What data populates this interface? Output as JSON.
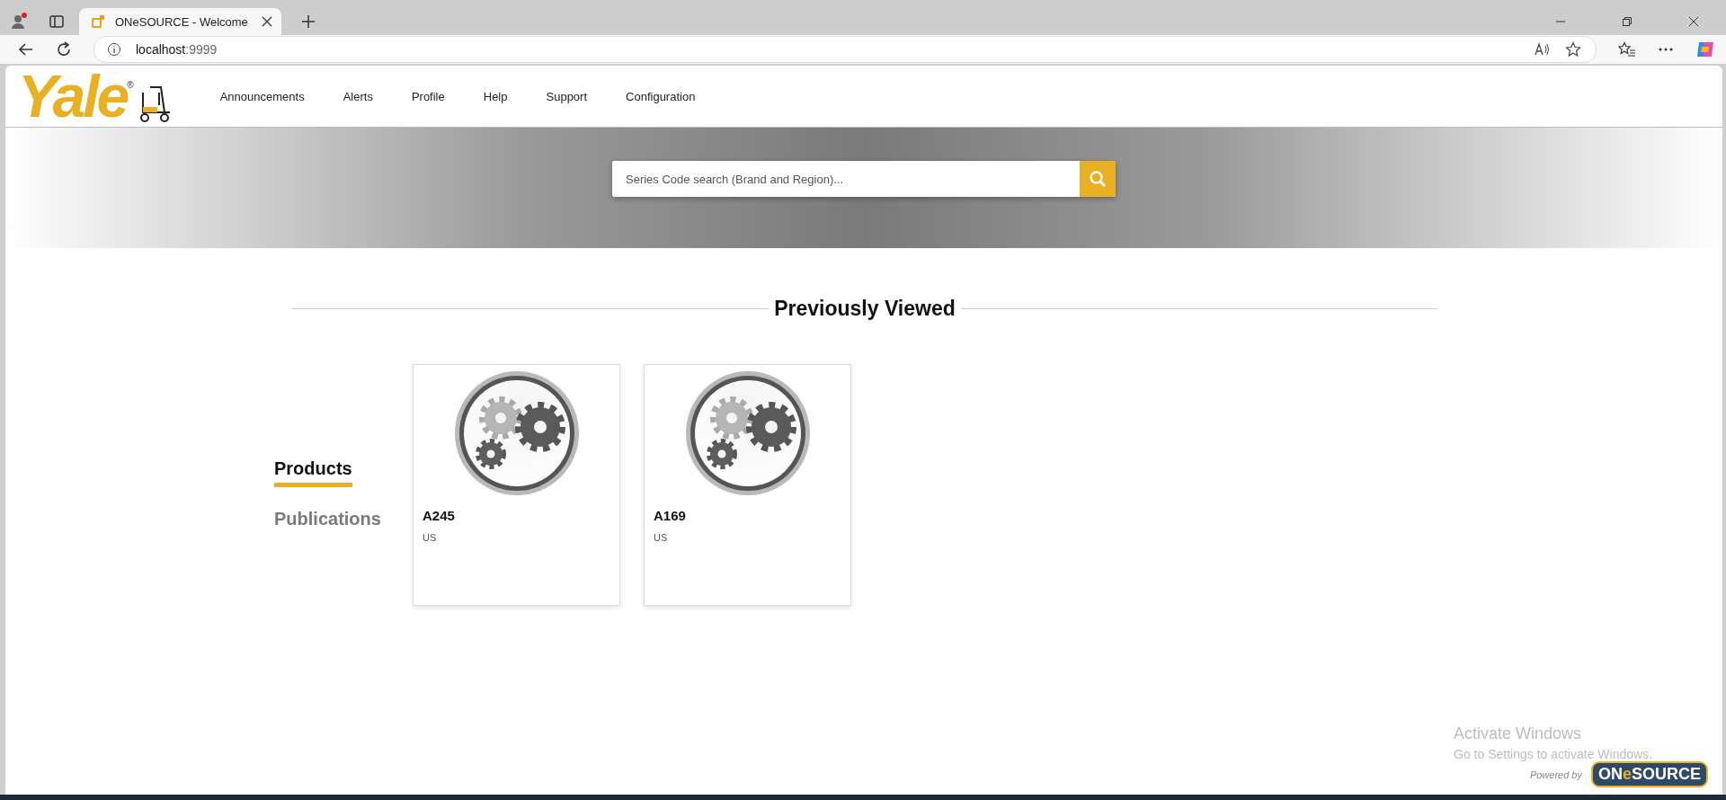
{
  "browser": {
    "tab_title": "ONeSOURCE - Welcome",
    "url_host": "localhost",
    "url_port": ":9999"
  },
  "header": {
    "logo": "Yale",
    "logo_mark": "®",
    "nav": [
      "Announcements",
      "Alerts",
      "Profile",
      "Help",
      "Support",
      "Configuration"
    ]
  },
  "search": {
    "placeholder": "Series Code search (Brand and Region)..."
  },
  "section_title": "Previously Viewed",
  "categories": [
    {
      "label": "Products",
      "selected": true
    },
    {
      "label": "Publications",
      "selected": false
    }
  ],
  "cards": [
    {
      "code": "A245",
      "region": "US"
    },
    {
      "code": "A169",
      "region": "US"
    }
  ],
  "os_notice": {
    "title": "Activate Windows",
    "text": "Go to Settings to activate Windows."
  },
  "footer": {
    "powered_by": "Powered by",
    "logo_prefix": "ON",
    "logo_highlight": "e",
    "logo_suffix": "SOURCE"
  }
}
